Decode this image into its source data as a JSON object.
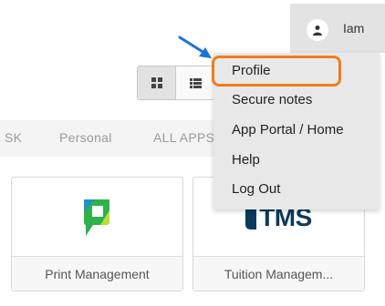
{
  "user": {
    "name": "Iam",
    "avatar_icon": "user-icon"
  },
  "view_toggle": {
    "grid_icon": "grid-view-icon",
    "list_icon": "list-view-icon",
    "active": "grid"
  },
  "tabs": [
    "SK",
    "Personal",
    "ALL APPS"
  ],
  "apps": [
    {
      "label": "Print Management",
      "icon": "print-management-logo",
      "accent": "#2db34a"
    },
    {
      "label": "Tuition Managem...",
      "icon_text": "TMS",
      "accent": "#0b3a5d"
    }
  ],
  "menu": {
    "items": [
      "Profile",
      "Secure notes",
      "App Portal / Home",
      "Help",
      "Log Out"
    ],
    "highlight_color": "#f07d1a"
  },
  "annotation": {
    "arrow_color": "#1a73d9"
  }
}
